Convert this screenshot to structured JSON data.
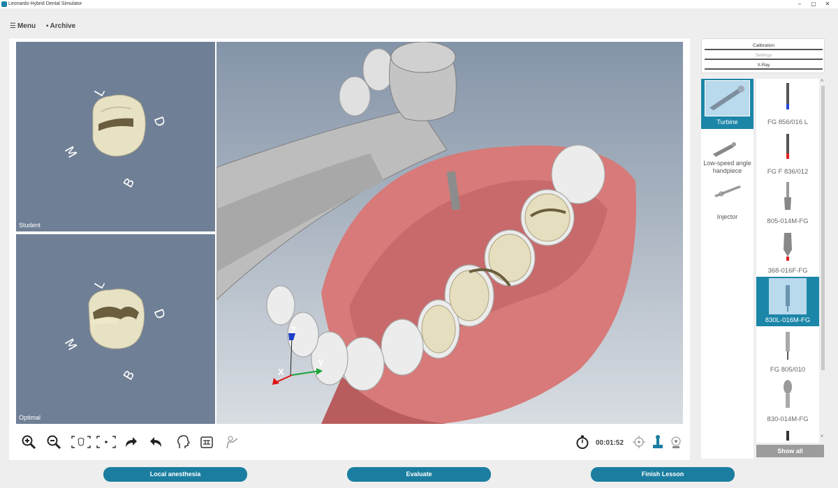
{
  "window": {
    "title": "Leonardo Hybrid Dental Simulator",
    "minimize": "–",
    "restore": "▢",
    "close": "✕"
  },
  "menubar": {
    "menu_label": "Menu",
    "archive_label": "Archive"
  },
  "views": {
    "student": {
      "label": "Student",
      "dirs": {
        "l": "L",
        "d": "D",
        "m": "M",
        "b": "B"
      }
    },
    "optimal": {
      "label": "Optimal",
      "dirs": {
        "l": "L",
        "d": "D",
        "m": "M",
        "b": "B"
      }
    }
  },
  "axes": {
    "x": "X",
    "y": "Y",
    "z": "Z"
  },
  "timer": {
    "value": "00:01:52"
  },
  "side_tabs": {
    "calibration": "Calibration",
    "settings": "Settings",
    "xray": "X-Ray"
  },
  "instruments": [
    {
      "label": "Turbine",
      "selected": true
    },
    {
      "label": "Low-speed angle handpiece",
      "selected": false
    },
    {
      "label": "Injector",
      "selected": false
    }
  ],
  "burs": [
    {
      "label": "FG 856/016 L",
      "selected": false
    },
    {
      "label": "FG F 836/012",
      "selected": false
    },
    {
      "label": "805-014M-FG",
      "selected": false
    },
    {
      "label": "368-016F-FG",
      "selected": false
    },
    {
      "label": "830L-016M-FG",
      "selected": true
    },
    {
      "label": "FG 805/010",
      "selected": false
    },
    {
      "label": "830-014M-FG",
      "selected": false
    }
  ],
  "show_all": "Show all",
  "actions": {
    "anesthesia": "Local anesthesia",
    "evaluate": "Evaluate",
    "finish": "Finish Lesson"
  },
  "colors": {
    "accent": "#1b7ea0",
    "view_bg": "#6f7f95",
    "gum": "#d8787a"
  }
}
